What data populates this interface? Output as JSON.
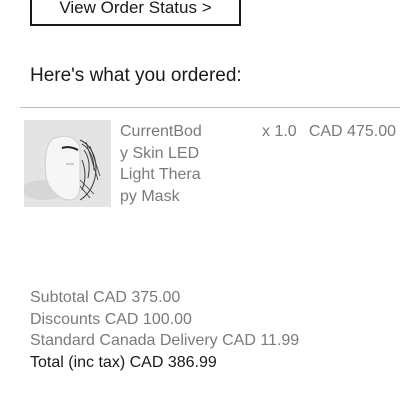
{
  "order_status_button": {
    "label": "View Order Status >"
  },
  "section_title": "Here's what you ordered:",
  "items": [
    {
      "name": "CurrentBody Skin LED Light Therapy Mask",
      "quantity": "x 1.0",
      "price": "CAD 475.00",
      "image_icon": "led-mask-product-image"
    }
  ],
  "totals": {
    "subtotal": "Subtotal CAD 375.00",
    "discounts": "Discounts CAD 100.00",
    "delivery": "Standard Canada Delivery CAD 11.99",
    "total": "Total (inc tax) CAD 386.99"
  }
}
